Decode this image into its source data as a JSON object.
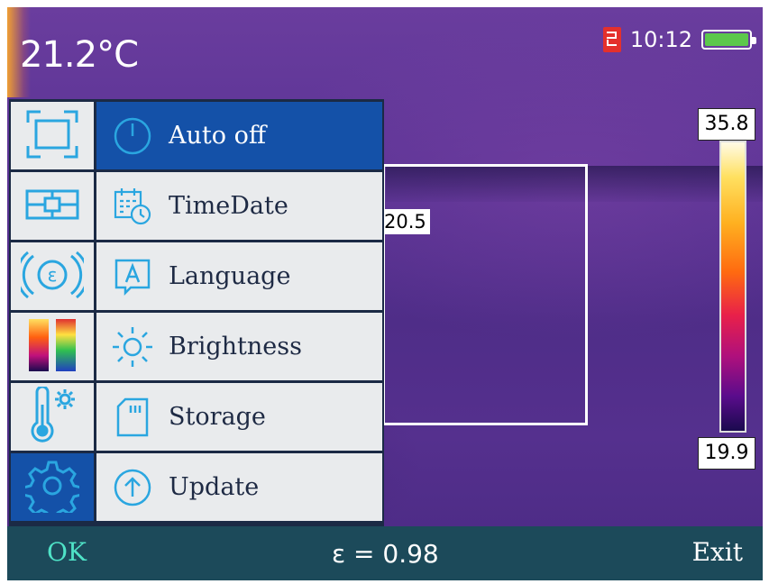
{
  "status": {
    "center_temp": "21.2°C",
    "time": "10:12",
    "battery_level": 1.0
  },
  "measurement": {
    "roi_value": "20.5"
  },
  "scale": {
    "max": "35.8",
    "min": "19.9"
  },
  "menu": {
    "categories": [
      {
        "icon": "frame-icon",
        "active": false
      },
      {
        "icon": "center-point-icon",
        "active": false
      },
      {
        "icon": "emissivity-icon",
        "active": false
      },
      {
        "icon": "palette-icon",
        "active": false
      },
      {
        "icon": "thermometer-settings-icon",
        "active": false
      },
      {
        "icon": "gear-icon",
        "active": true
      }
    ],
    "items": [
      {
        "label": "Auto off",
        "icon": "power-icon",
        "active": true
      },
      {
        "label": "TimeDate",
        "icon": "calendar-clock-icon",
        "active": false
      },
      {
        "label": "Language",
        "icon": "language-icon",
        "active": false
      },
      {
        "label": "Brightness",
        "icon": "sun-icon",
        "active": false
      },
      {
        "label": "Storage",
        "icon": "sd-card-icon",
        "active": false
      },
      {
        "label": "Update",
        "icon": "upload-icon",
        "active": false
      }
    ]
  },
  "bottom_bar": {
    "ok_label": "OK",
    "emissivity": "ε = 0.98",
    "exit_label": "Exit"
  },
  "colors": {
    "accent_blue": "#1451a8",
    "icon_blue": "#2aa6e0",
    "ok_green": "#4fe3c7",
    "bar_bg": "#1c4a5a"
  }
}
